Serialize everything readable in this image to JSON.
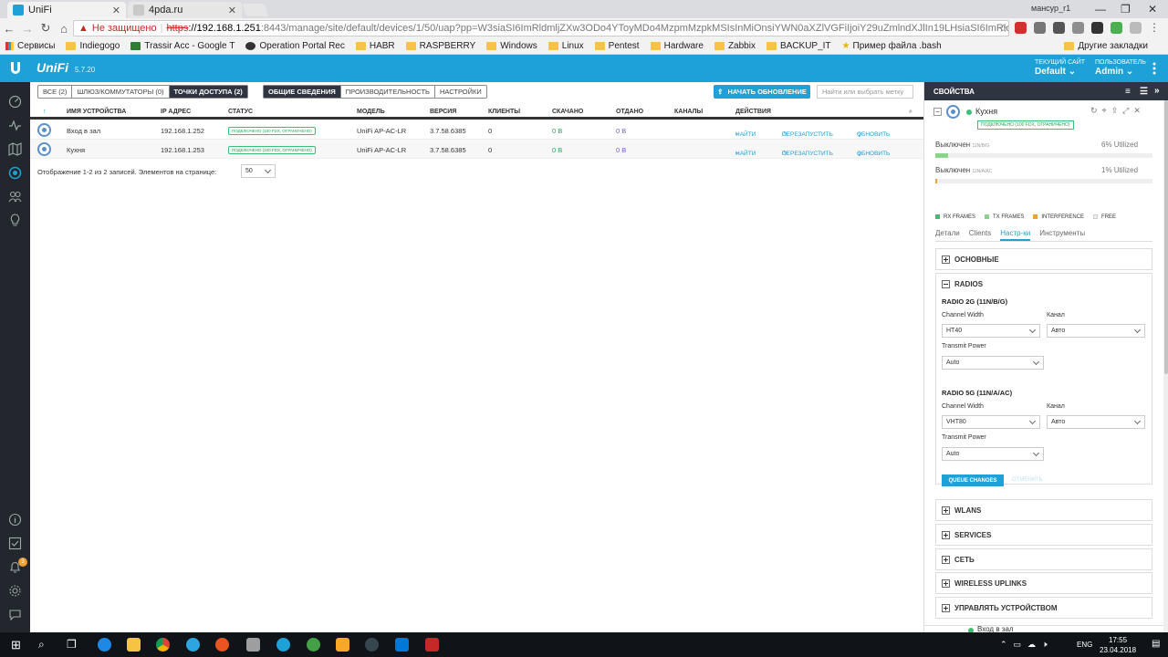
{
  "browser": {
    "tabs": [
      {
        "title": "UniFi",
        "active": true
      },
      {
        "title": "4pda.ru",
        "active": false
      }
    ],
    "user_chip": "мансур_r1",
    "security_warning": "Не защищено",
    "url_scheme": "https",
    "url_host": "://192.168.1.251",
    "url_path": ":8443/manage/site/default/devices/1/50/uap?pp=W3siaSI6ImRldmljZXw3ODo4YToyMDo4MzpmMzpkMSIsInMiOnsiYWN0aXZlVGFiIjoiY29uZmlndXJlIn19LHsiaSI6ImRldmljZXw3ODo4YToyMDo4MzpmY...",
    "bookmarks": [
      "Сервисы",
      "Indiegogo",
      "Trassir Acc - Google Т",
      "Operation Portal Rec",
      "HABR",
      "RASPBERRY",
      "Windows",
      "Linux",
      "Pentest",
      "Hardware",
      "Zabbix",
      "BACKUP_IT",
      "Пример файла .bash"
    ],
    "other_bookmarks": "Другие закладки"
  },
  "header": {
    "brand": "UniFi",
    "version": "5.7.20",
    "site_label": "ТЕКУЩИЙ САЙТ",
    "site_value": "Default",
    "user_label": "ПОЛЬЗОВАТЕЛЬ",
    "user_value": "Admin"
  },
  "filters": {
    "all": "ВСЕ (2)",
    "gateways": "ШЛЮЗ/КОММУТАТОРЫ (0)",
    "aps": "ТОЧКИ ДОСТУПА (2)",
    "overview": "ОБЩИЕ СВЕДЕНИЯ",
    "performance": "ПРОИЗВОДИТЕЛЬНОСТЬ",
    "settings": "НАСТРОЙКИ",
    "upgrade": "НАЧАТЬ ОБНОВЛЕНИЕ",
    "search_placeholder": "Найти или выбрать метку"
  },
  "table": {
    "columns": [
      "ИМЯ УСТРОЙСТВА",
      "IP АДРЕС",
      "СТАТУС",
      "МОДЕЛЬ",
      "ВЕРСИЯ",
      "КЛИЕНТЫ",
      "СКАЧАНО",
      "ОТДАНО",
      "КАНАЛЫ",
      "ДЕЙСТВИЯ"
    ],
    "rows": [
      {
        "name": "Вход в зал",
        "ip": "192.168.1.252",
        "status": "подключено (100 FDX, ограничено)",
        "model": "UniFi AP-AC-LR",
        "version": "3.7.58.6385",
        "clients": "0",
        "down": "0 B",
        "up": "0 B"
      },
      {
        "name": "Кухня",
        "ip": "192.168.1.253",
        "status": "подключено (100 FDX, ограничено)",
        "model": "UniFi AP-AC-LR",
        "version": "3.7.58.6385",
        "clients": "0",
        "down": "0 B",
        "up": "0 B"
      }
    ],
    "action_find": "НАЙТИ",
    "action_restart": "ПЕРЕЗАПУСТИТЬ",
    "action_update": "ОБНОВИТЬ",
    "footer": "Отображение 1-2 из 2 записей.   Элементов на странице:",
    "per_page": "50"
  },
  "panel": {
    "title": "СВОЙСТВА",
    "device_name": "Кухня",
    "device_status": "ПОДКЛЮЧЕНО (100 FDX, ОГРАНИЧЕНО)",
    "radio_off_1": "Выключен",
    "radio_off_1_band": "11N/B/G",
    "util_1": "6% Utilized",
    "util_1_fraction": 0.06,
    "radio_off_2": "Выключен",
    "radio_off_2_band": "11N/A/AC",
    "util_2": "1% Utilized",
    "util_2_fraction": 0.01,
    "legend": [
      "RX FRAMES",
      "TX FRAMES",
      "INTERFERENCE",
      "FREE"
    ],
    "legend_colors": [
      "#38c172",
      "#8bd28b",
      "#f0a030",
      "#eeeeee"
    ],
    "subtabs": [
      "Детали",
      "Clients",
      "Настр-ки",
      "Инструменты"
    ],
    "section_basic": "ОСНОВНЫЕ",
    "section_radios": "RADIOS",
    "radio2g_title": "RADIO 2G (11N/B/G)",
    "radio5g_title": "RADIO 5G (11N/A/AC)",
    "channel_width_label": "Channel Width",
    "channel_label": "Канал",
    "tx_power_label": "Transmit Power",
    "r2_width": "HT40",
    "r2_channel": "Авто",
    "r2_power": "Auto",
    "r5_width": "VHT80",
    "r5_channel": "Авто",
    "r5_power": "Auto",
    "queue_btn": "QUEUE CHANGES",
    "cancel_btn": "ОТМЕНИТЬ",
    "section_wlans": "WLANS",
    "section_services": "SERVICES",
    "section_network": "СЕТЬ",
    "section_uplinks": "WIRELESS UPLINKS",
    "section_manage": "УПРАВЛЯТЬ УСТРОЙСТВОМ",
    "next_device": "Вход в зал"
  },
  "taskbar": {
    "lang": "ENG",
    "time": "17:55",
    "date": "23.04.2018",
    "notif_count": "3"
  },
  "colors": {
    "accent": "#1da1d6",
    "dark": "#23272d",
    "status_green": "#38c172"
  }
}
